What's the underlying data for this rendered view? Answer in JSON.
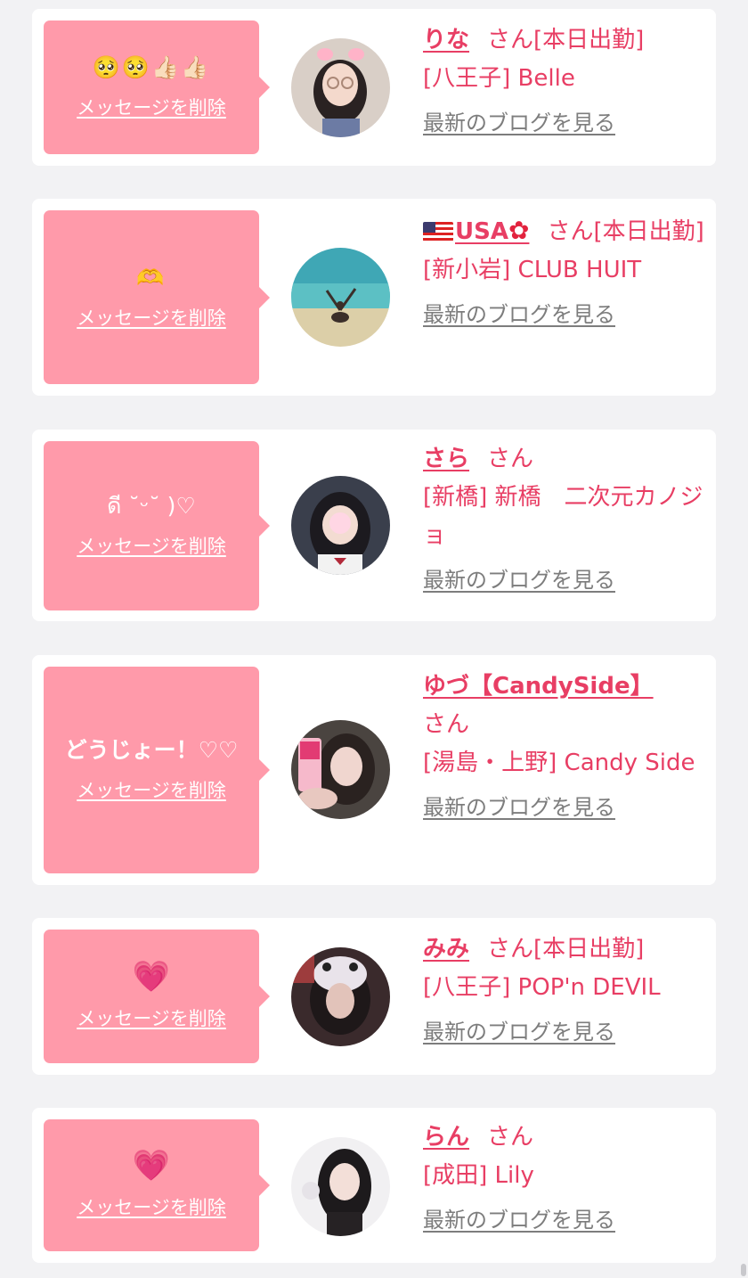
{
  "ui": {
    "delete_label": "メッセージを削除",
    "blog_label": "最新のブログを見る",
    "san": "さん",
    "today": "[本日出勤]"
  },
  "cards": [
    {
      "message": "🥺🥺👍🏻👍🏻",
      "name": "りな",
      "status": "[本日出勤]",
      "shop": "[八王子] Belle"
    },
    {
      "message": "🫶",
      "name": "USA",
      "status": "[本日出勤]",
      "shop": "[新小岩] CLUB HUIT"
    },
    {
      "message": "ดี ˘ᵕ˘ )♡",
      "name": "さら",
      "status": "",
      "shop": "[新橋] 新橋　二次元カノジョ"
    },
    {
      "message": "どうじょー！♡♡",
      "name": "ゆづ【CandySide】",
      "status": "",
      "shop": "[湯島・上野] Candy Side"
    },
    {
      "message": "💗",
      "name": "みみ",
      "status": "[本日出勤]",
      "shop": "[八王子] POP'n DEVIL"
    },
    {
      "message": "💗",
      "name": "らん",
      "status": "",
      "shop": "[成田] Lily"
    }
  ],
  "icons": [
    "us-flag-icon",
    "hibiscus-icon",
    "heart-icon"
  ]
}
